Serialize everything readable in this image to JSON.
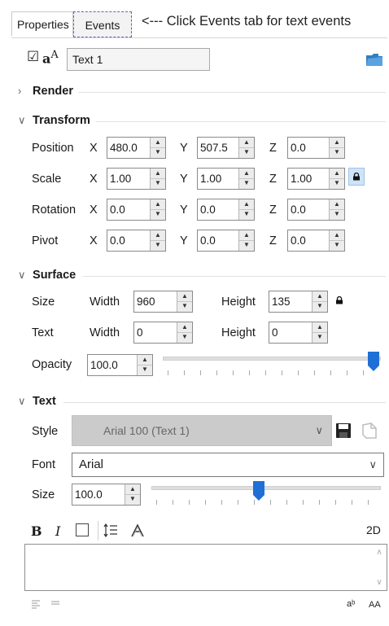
{
  "tabs": {
    "properties": "Properties",
    "events": "Events",
    "hint": "<--- Click Events tab for text events"
  },
  "object": {
    "checkbox_mark": "☑",
    "name": "Text 1"
  },
  "sections": {
    "render": "Render",
    "transform": "Transform",
    "surface": "Surface",
    "text": "Text"
  },
  "transform": {
    "position": {
      "label": "Position",
      "x": "480.0",
      "y": "507.5",
      "z": "0.0"
    },
    "scale": {
      "label": "Scale",
      "x": "1.00",
      "y": "1.00",
      "z": "1.00"
    },
    "rotation": {
      "label": "Rotation",
      "x": "0.0",
      "y": "0.0",
      "z": "0.0"
    },
    "pivot": {
      "label": "Pivot",
      "x": "0.0",
      "y": "0.0",
      "z": "0.0"
    },
    "axis_x": "X",
    "axis_y": "Y",
    "axis_z": "Z"
  },
  "surface": {
    "size_label": "Size",
    "text_label": "Text",
    "width_label": "Width",
    "height_label": "Height",
    "size_width": "960",
    "size_height": "135",
    "text_width": "0",
    "text_height": "0",
    "opacity_label": "Opacity",
    "opacity": "100.0",
    "opacity_slider_fraction": 1.0
  },
  "text": {
    "style_label": "Style",
    "style_value": "Arial 100 (Text 1)",
    "font_label": "Font",
    "font_value": "Arial",
    "size_label": "Size",
    "size_value": "100.0",
    "size_slider_fraction": 0.47,
    "bold": "B",
    "italic": "I",
    "mode_2d": "2D",
    "aa": "AA"
  },
  "colors": {
    "accent_blue": "#1e6fd6",
    "tab_focus": "#6a5acd"
  }
}
